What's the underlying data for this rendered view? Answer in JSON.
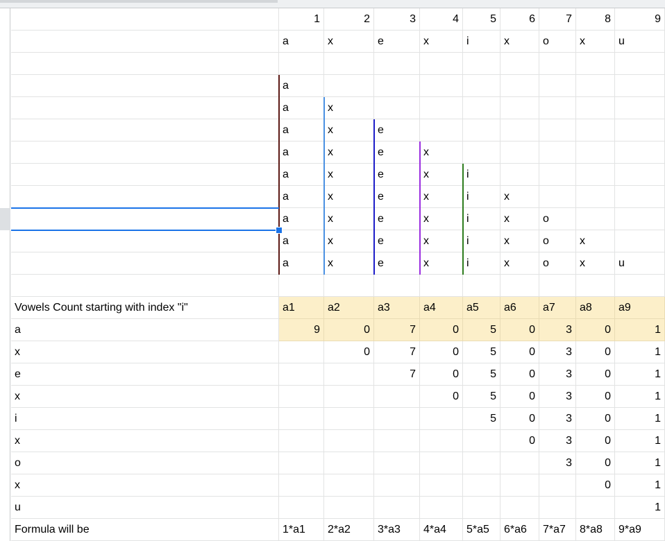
{
  "sheet": {
    "header_numbers": [
      "1",
      "2",
      "3",
      "4",
      "5",
      "6",
      "7",
      "8",
      "9"
    ],
    "input_chars": [
      "a",
      "x",
      "e",
      "x",
      "i",
      "x",
      "o",
      "x",
      "u"
    ],
    "triangle_rows": [
      [
        "a"
      ],
      [
        "a",
        "x"
      ],
      [
        "a",
        "x",
        "e"
      ],
      [
        "a",
        "x",
        "e",
        "x"
      ],
      [
        "a",
        "x",
        "e",
        "x",
        "i"
      ],
      [
        "a",
        "x",
        "e",
        "x",
        "i",
        "x"
      ],
      [
        "a",
        "x",
        "e",
        "x",
        "i",
        "x",
        "o"
      ],
      [
        "a",
        "x",
        "e",
        "x",
        "i",
        "x",
        "o",
        "x"
      ],
      [
        "a",
        "x",
        "e",
        "x",
        "i",
        "x",
        "o",
        "x",
        "u"
      ]
    ],
    "line_colors": [
      "#5c1a16",
      "#4a90e2",
      "#1c1cc8",
      "#9b2de0",
      "#2e7d1e"
    ],
    "vowels_label": "Vowels Count starting with index \"i\"",
    "count_headers": [
      "a1",
      "a2",
      "a3",
      "a4",
      "a5",
      "a6",
      "a7",
      "a8",
      "a9"
    ],
    "count_rows": [
      {
        "label": "a",
        "values": [
          "9",
          "0",
          "7",
          "0",
          "5",
          "0",
          "3",
          "0",
          "1"
        ]
      },
      {
        "label": "x",
        "values": [
          "",
          "0",
          "7",
          "0",
          "5",
          "0",
          "3",
          "0",
          "1"
        ]
      },
      {
        "label": "e",
        "values": [
          "",
          "",
          "7",
          "0",
          "5",
          "0",
          "3",
          "0",
          "1"
        ]
      },
      {
        "label": "x",
        "values": [
          "",
          "",
          "",
          "0",
          "5",
          "0",
          "3",
          "0",
          "1"
        ]
      },
      {
        "label": "i",
        "values": [
          "",
          "",
          "",
          "",
          "5",
          "0",
          "3",
          "0",
          "1"
        ]
      },
      {
        "label": "x",
        "values": [
          "",
          "",
          "",
          "",
          "",
          "0",
          "3",
          "0",
          "1"
        ]
      },
      {
        "label": "o",
        "values": [
          "",
          "",
          "",
          "",
          "",
          "",
          "3",
          "0",
          "1"
        ]
      },
      {
        "label": "x",
        "values": [
          "",
          "",
          "",
          "",
          "",
          "",
          "",
          "0",
          "1"
        ]
      },
      {
        "label": "u",
        "values": [
          "",
          "",
          "",
          "",
          "",
          "",
          "",
          "",
          "1"
        ]
      }
    ],
    "formula_label": "Formula will be",
    "formulas": [
      "1*a1",
      "2*a2",
      "3*a3",
      "4*a4",
      "5*a5",
      "6*a6",
      "7*a7",
      "8*a8",
      "9*a9"
    ],
    "highlight_color": "#fcefc9",
    "selection_color": "#1a73e8"
  }
}
